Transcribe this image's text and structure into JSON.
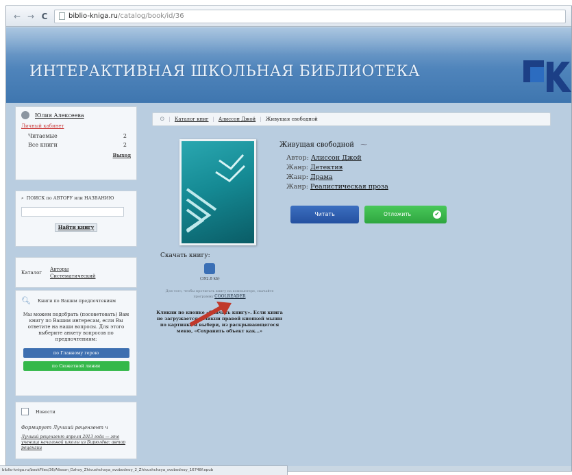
{
  "browser": {
    "url_host": "biblio-kniga.ru",
    "url_path": "/catalog/book/id/36",
    "status_url": "biblio-kniga.ru/bookFiles/36/Alisson_Dzhoy_Zhivushchaya_svobodnoy_2_Zhivushchaya_svobodnoy_16748f.epub"
  },
  "header": {
    "title": "ИНТЕРАКТИВНАЯ ШКОЛЬНАЯ БИБЛИОТЕКА",
    "brand_color": "#4f84bb"
  },
  "sidebar": {
    "user": {
      "name": "Юлия Алексеева",
      "cabinet": "Личный кабинет",
      "stats": [
        {
          "label": "Читаемые",
          "value": "2"
        },
        {
          "label": "Все книги",
          "value": "2"
        }
      ],
      "logout": "Выход"
    },
    "search": {
      "title": "ПОИСК по АВТОРУ или НАЗВАНИЮ",
      "button": "Найти книгу"
    },
    "catalog": {
      "label": "Каталог",
      "links": [
        "Авторы",
        "Систематический"
      ]
    },
    "help": {
      "head": "Книги по Вашим предпочтениям",
      "text": "Мы можем подобрать (посоветовать) Вам книгу по Вашим интересам, если Вы ответите на наши вопросы. Для этого выберите анкету вопросов по предпочтениям:",
      "btn_blue": "по Главному герою",
      "btn_green": "по Сюжетной линии"
    },
    "news": {
      "head": "Новости",
      "title": "Формирует Лучший рецензент ч",
      "link": "Лучший рецензент апреля 2013 года — это ученица начальной школы из Бирюлёва: автор рецензии"
    }
  },
  "breadcrumb": {
    "items": [
      "Каталог книг",
      "Алиссон Джой",
      "Живущая свободной"
    ]
  },
  "book": {
    "title": "Живущая свободной",
    "author_label": "Автор:",
    "author": "Алиссон Джой",
    "genres_label": "Жанр:",
    "genres": [
      "Детектив",
      "Драма",
      "Реалистическая проза"
    ],
    "read_btn": "Читать",
    "mark_btn": "Отложить",
    "download_title": "Скачать книгу:",
    "file_size": "(392.8 kb)",
    "download_note": "Для того, чтобы прочитать книгу на компьютере, скачайте программу",
    "reader": "COOLREADER",
    "help_text": "Кликни по кнопке «Скачать книгу». Если книга не загружается, кликни правой кнопкой мыши по картинке и выбери, из раскрывающегося меню, «Сохранить объект как…»"
  }
}
